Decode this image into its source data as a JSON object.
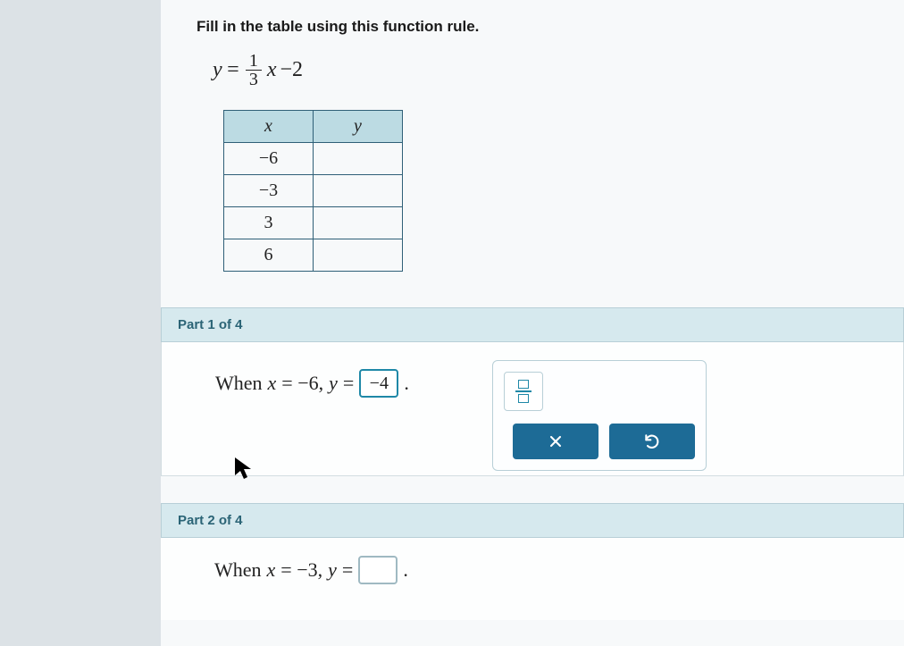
{
  "prompt": "Fill in the table using this function rule.",
  "equation": {
    "lhs": "y",
    "eq": "=",
    "frac_num": "1",
    "frac_den": "3",
    "var": "x",
    "tail": "−2"
  },
  "table": {
    "headers": {
      "x": "x",
      "y": "y"
    },
    "rows": [
      {
        "x": "−6",
        "y": ""
      },
      {
        "x": "−3",
        "y": ""
      },
      {
        "x": "3",
        "y": ""
      },
      {
        "x": "6",
        "y": ""
      }
    ]
  },
  "part1": {
    "label": "Part 1 of 4",
    "text_prefix": "When ",
    "xvar": "x",
    "eq1": "= −6, ",
    "yvar": "y",
    "eq2": "=",
    "answer": "−4",
    "period": "."
  },
  "toolbox": {
    "frac_tool": "fraction-tool",
    "clear": "clear",
    "undo": "undo"
  },
  "part2": {
    "label": "Part 2 of 4",
    "text_prefix": "When ",
    "xvar": "x",
    "eq1": "= −3, ",
    "yvar": "y",
    "eq2": "=",
    "answer": "",
    "period": "."
  }
}
